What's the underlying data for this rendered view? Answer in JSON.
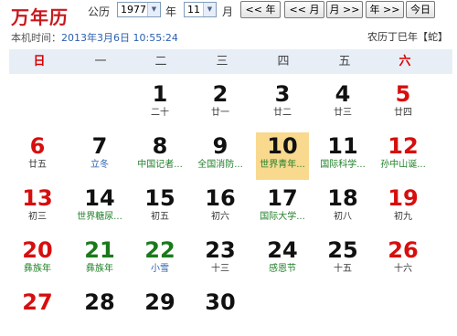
{
  "brand": "万年历",
  "controls": {
    "gongli_label": "公历",
    "year_value": "1977",
    "year_label": "年",
    "month_value": "11",
    "month_label": "月",
    "prev_year": "<< 年",
    "prev_month": "<< 月",
    "next_month": "月 >>",
    "next_year": "年 >>",
    "today": "今日"
  },
  "system_time": {
    "label": "本机时间：",
    "value": "2013年3月6日 10:55:24"
  },
  "lunar_info": "农历丁巳年【蛇】",
  "weekdays": [
    "日",
    "一",
    "二",
    "三",
    "四",
    "五",
    "六"
  ],
  "days": [
    {
      "d": "1",
      "s": "二十"
    },
    {
      "d": "2",
      "s": "廿一"
    },
    {
      "d": "3",
      "s": "廿二"
    },
    {
      "d": "4",
      "s": "廿三"
    },
    {
      "d": "5",
      "s": "廿四"
    },
    {
      "d": "6",
      "s": "廿五"
    },
    {
      "d": "7",
      "s": "立冬"
    },
    {
      "d": "8",
      "s": "中国记者..."
    },
    {
      "d": "9",
      "s": "全国消防..."
    },
    {
      "d": "10",
      "s": "世界青年..."
    },
    {
      "d": "11",
      "s": "国际科学..."
    },
    {
      "d": "12",
      "s": "孙中山诞..."
    },
    {
      "d": "13",
      "s": "初三"
    },
    {
      "d": "14",
      "s": "世界糖尿..."
    },
    {
      "d": "15",
      "s": "初五"
    },
    {
      "d": "16",
      "s": "初六"
    },
    {
      "d": "17",
      "s": "国际大学..."
    },
    {
      "d": "18",
      "s": "初八"
    },
    {
      "d": "19",
      "s": "初九"
    },
    {
      "d": "20",
      "s": "彝族年"
    },
    {
      "d": "21",
      "s": "彝族年"
    },
    {
      "d": "22",
      "s": "小雪"
    },
    {
      "d": "23",
      "s": "十三"
    },
    {
      "d": "24",
      "s": "感恩节"
    },
    {
      "d": "25",
      "s": "十五"
    },
    {
      "d": "26",
      "s": "十六"
    },
    {
      "d": "27",
      "s": ""
    },
    {
      "d": "28",
      "s": ""
    },
    {
      "d": "29",
      "s": ""
    },
    {
      "d": "30",
      "s": ""
    }
  ],
  "colors": {
    "brand": "#c8191c",
    "weekend": "#d70e0e",
    "today_bg": "#f8d98e",
    "header_bg": "#e8eef6",
    "festival": "#22802a",
    "solar_term": "#2b5faf"
  }
}
